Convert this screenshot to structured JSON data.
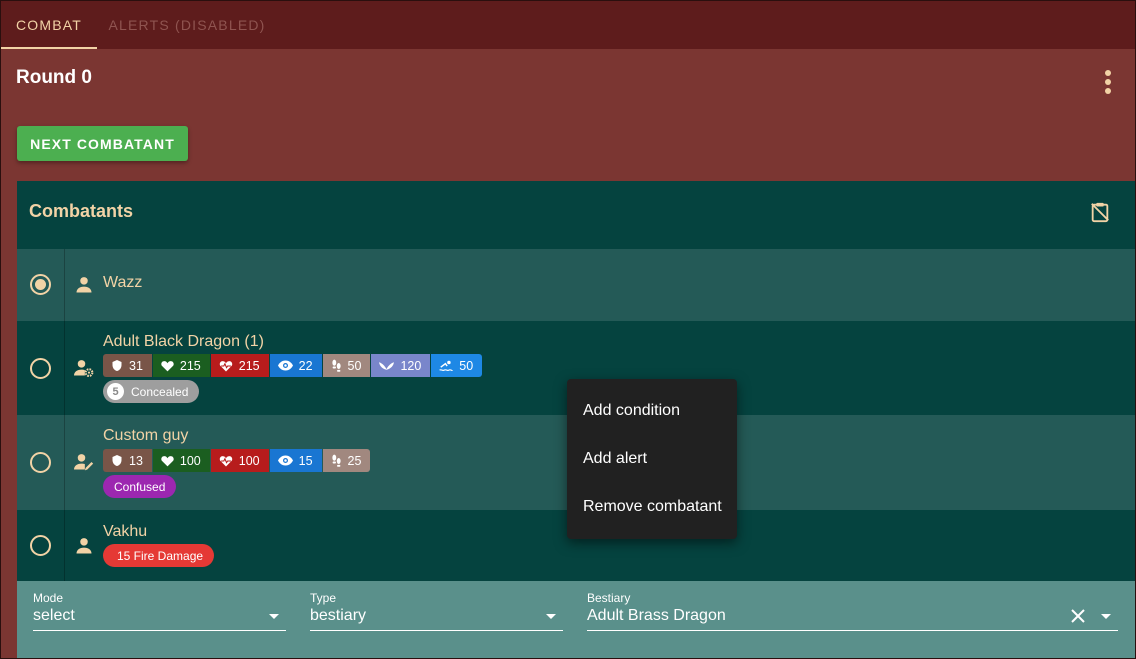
{
  "tabs": [
    {
      "label": "COMBAT",
      "active": true
    },
    {
      "label": "ALERTS (DISABLED)",
      "active": false
    }
  ],
  "header": {
    "round_label": "Round 0"
  },
  "next_button": {
    "label": "NEXT COMBATANT"
  },
  "combatants_panel": {
    "title": "Combatants",
    "rows": [
      {
        "name": "Wazz",
        "selected": true,
        "type_icon": "person-icon",
        "stats": [],
        "conditions": []
      },
      {
        "name": "Adult Black Dragon (1)",
        "selected": false,
        "type_icon": "person-gear-icon",
        "stats": [
          {
            "icon": "shield-icon",
            "value": "31",
            "color": "#795548"
          },
          {
            "icon": "heart-icon",
            "value": "215",
            "color": "#1b5e20"
          },
          {
            "icon": "heart-pulse-icon",
            "value": "215",
            "color": "#b71c1c"
          },
          {
            "icon": "eye-icon",
            "value": "22",
            "color": "#1976d2"
          },
          {
            "icon": "footsteps-icon",
            "value": "50",
            "color": "#a1887f"
          },
          {
            "icon": "wings-icon",
            "value": "120",
            "color": "#7986cb"
          },
          {
            "icon": "swim-icon",
            "value": "50",
            "color": "#1e88e5"
          }
        ],
        "conditions": [
          {
            "badge": "5",
            "label": "Concealed",
            "color": "#9e9e9e"
          }
        ]
      },
      {
        "name": "Custom guy",
        "selected": false,
        "type_icon": "person-edit-icon",
        "stats": [
          {
            "icon": "shield-icon",
            "value": "13",
            "color": "#795548"
          },
          {
            "icon": "heart-icon",
            "value": "100",
            "color": "#1b5e20"
          },
          {
            "icon": "heart-pulse-icon",
            "value": "100",
            "color": "#b71c1c"
          },
          {
            "icon": "eye-icon",
            "value": "15",
            "color": "#1976d2"
          },
          {
            "icon": "footsteps-icon",
            "value": "25",
            "color": "#a1887f"
          }
        ],
        "conditions": [
          {
            "badge": "",
            "label": "Confused",
            "color": "#9c27b0"
          }
        ]
      },
      {
        "name": "Vakhu",
        "selected": false,
        "type_icon": "person-icon",
        "stats": [],
        "conditions": [
          {
            "badge": "",
            "label": "15 Fire Damage",
            "color": "#e53935"
          }
        ]
      }
    ]
  },
  "form": {
    "mode": {
      "label": "Mode",
      "value": "select"
    },
    "type": {
      "label": "Type",
      "value": "bestiary"
    },
    "bestiary": {
      "label": "Bestiary",
      "value": "Adult Brass Dragon"
    }
  },
  "context_menu": {
    "items": [
      "Add condition",
      "Add alert",
      "Remove combatant"
    ]
  },
  "colors": {
    "app_bg": "#7b3632",
    "tab_bar": "#5e1c1c",
    "accent": "#f2d3a6",
    "panel_header": "#05433f",
    "row_light": "#245a57",
    "row_dark": "#05433f",
    "form_bg": "#5a908b",
    "next_button": "#4caf50",
    "menu_bg": "#212121"
  }
}
